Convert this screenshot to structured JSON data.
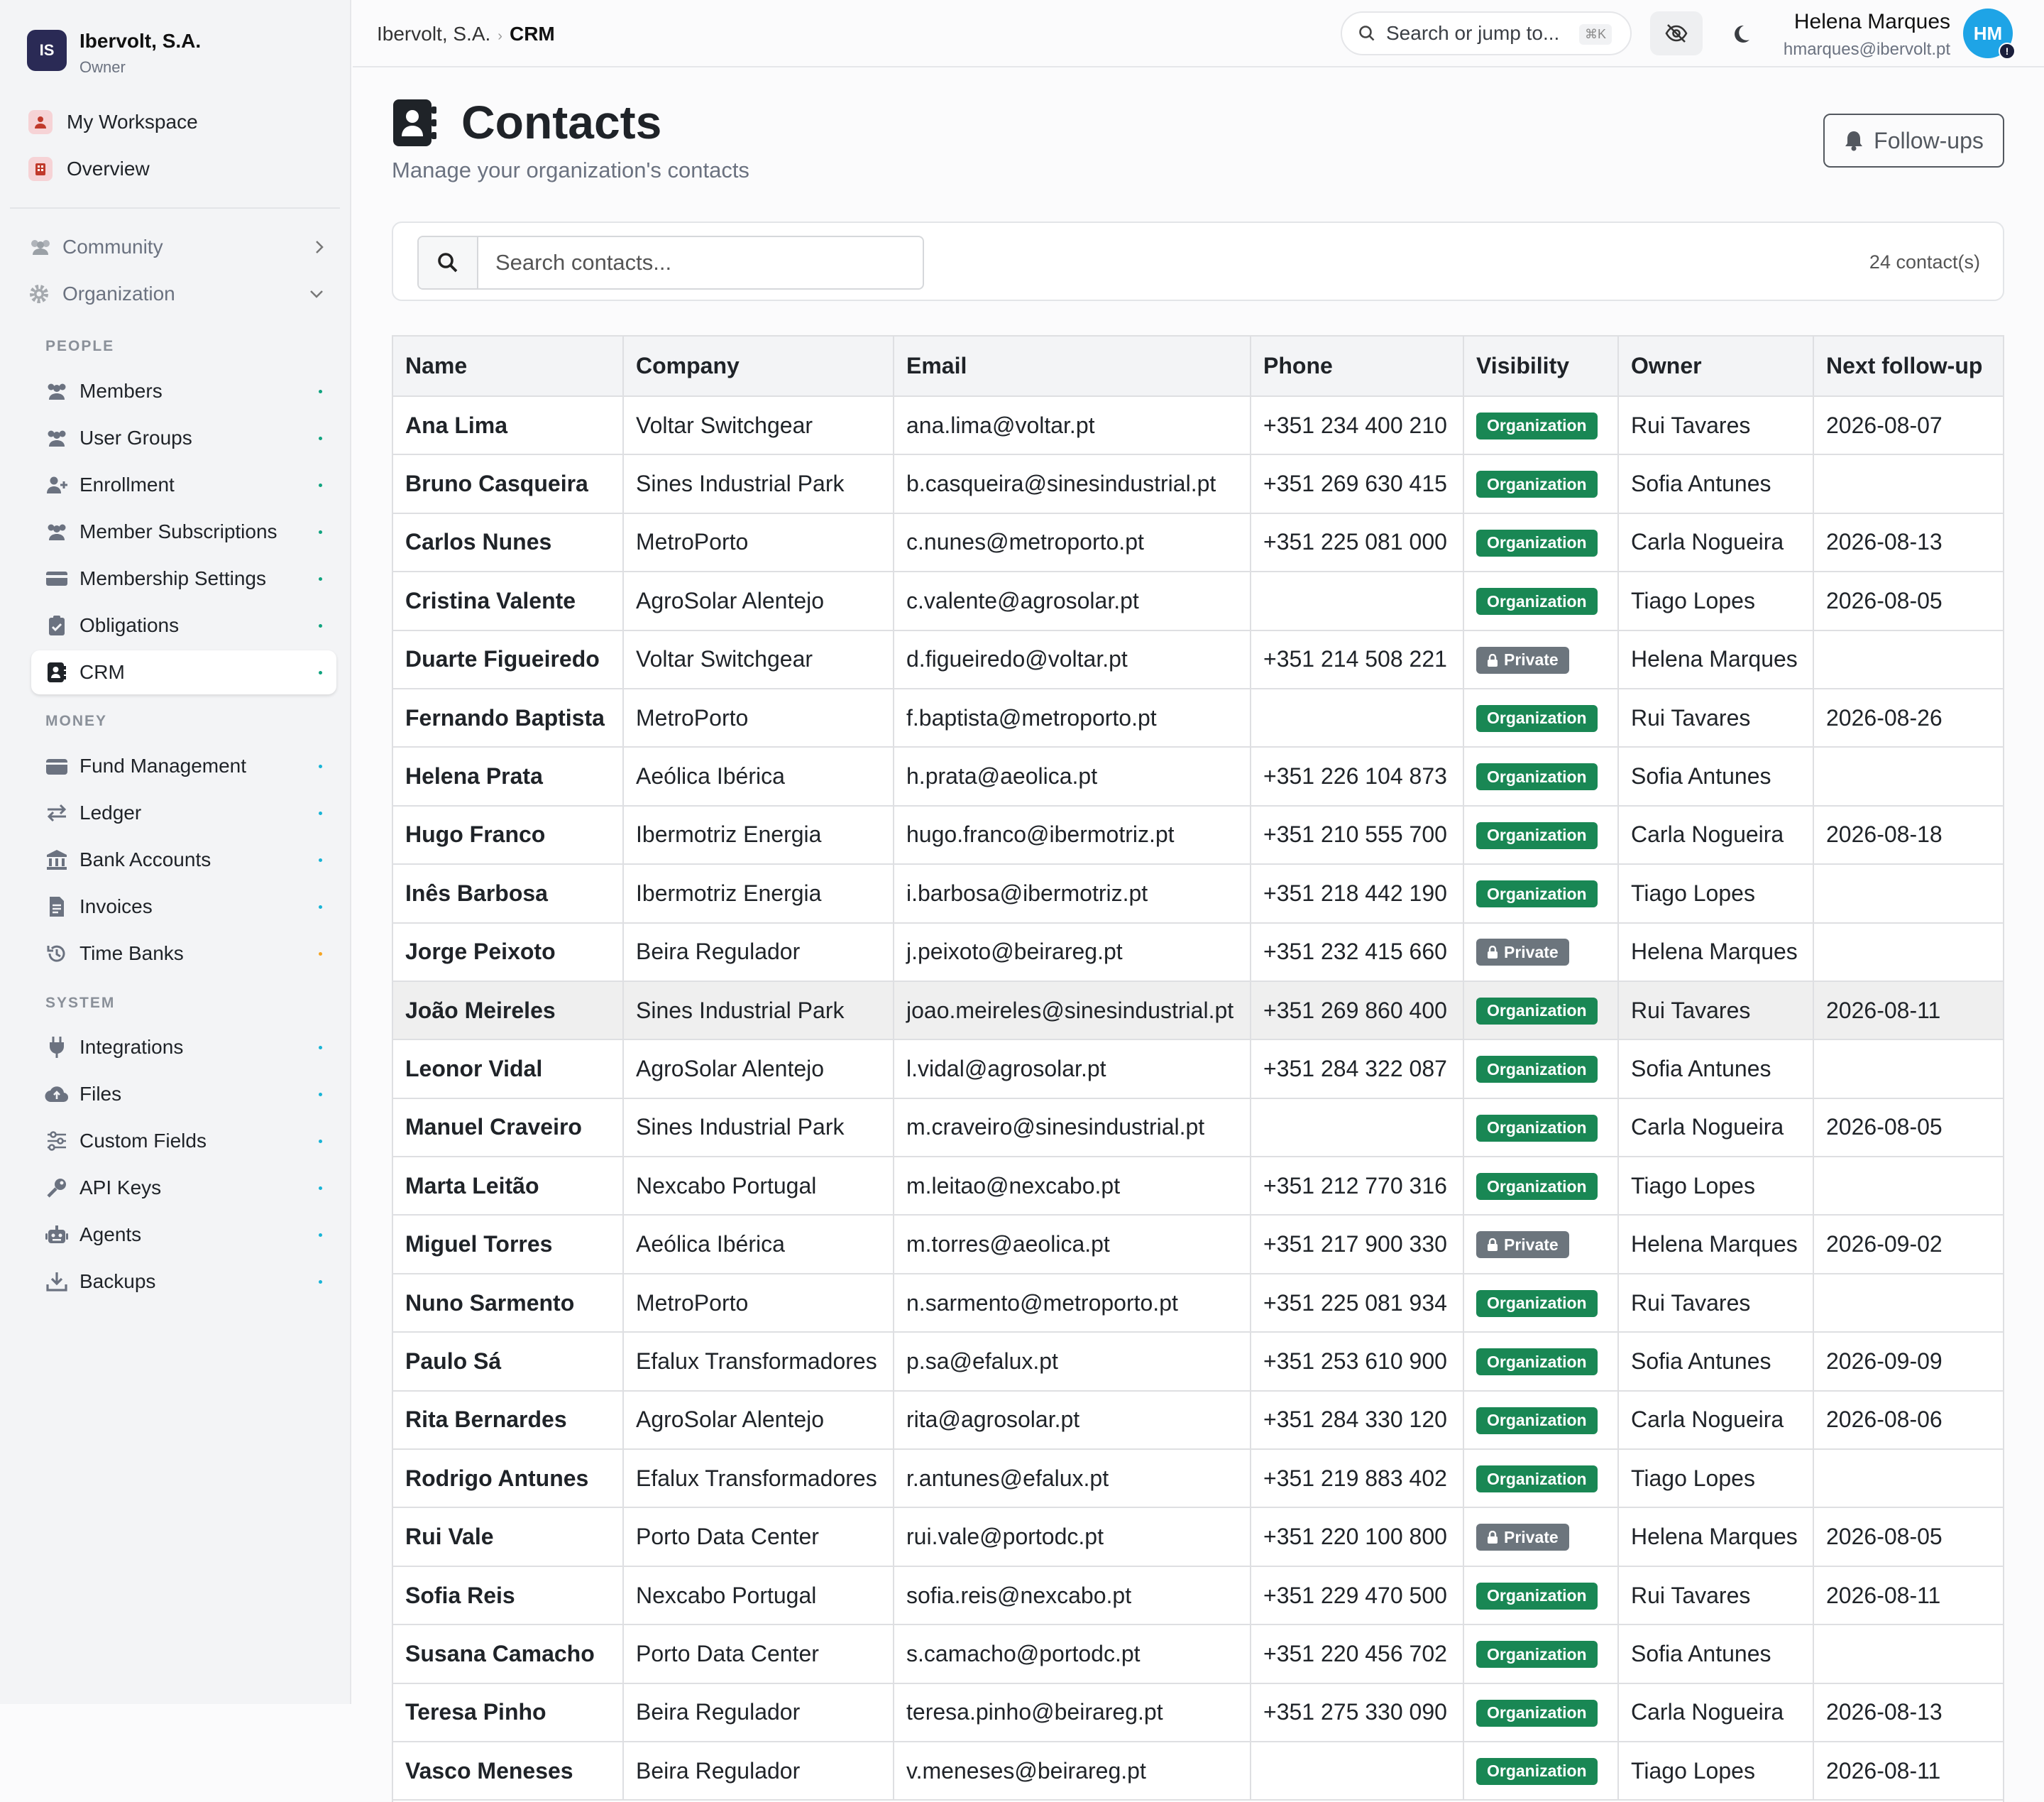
{
  "org": {
    "initials": "IS",
    "name": "Ibervolt, S.A.",
    "role": "Owner"
  },
  "sidebar": {
    "top_links": [
      {
        "label": "My Workspace",
        "icon": "user-icon"
      },
      {
        "label": "Overview",
        "icon": "building-icon"
      }
    ],
    "groups": [
      {
        "label": "Community",
        "icon": "people-icon"
      },
      {
        "label": "Organization",
        "icon": "gear-icon"
      }
    ],
    "sections": {
      "people": "PEOPLE",
      "money": "MONEY",
      "system": "SYSTEM"
    },
    "items": [
      {
        "label": "Members",
        "icon": "members-icon"
      },
      {
        "label": "User Groups",
        "icon": "user-groups-icon"
      },
      {
        "label": "Enrollment",
        "icon": "user-plus-icon"
      },
      {
        "label": "Member Subscriptions",
        "icon": "subscriptions-icon"
      },
      {
        "label": "Membership Settings",
        "icon": "card-icon"
      },
      {
        "label": "Obligations",
        "icon": "clipboard-icon"
      },
      {
        "label": "CRM",
        "icon": "contact-book-icon"
      },
      {
        "label": "Fund Management",
        "icon": "wallet-icon"
      },
      {
        "label": "Ledger",
        "icon": "arrows-icon"
      },
      {
        "label": "Bank Accounts",
        "icon": "bank-icon"
      },
      {
        "label": "Invoices",
        "icon": "invoice-icon"
      },
      {
        "label": "Time Banks",
        "icon": "history-icon"
      },
      {
        "label": "Integrations",
        "icon": "plug-icon"
      },
      {
        "label": "Files",
        "icon": "cloud-icon"
      },
      {
        "label": "Custom Fields",
        "icon": "sliders-icon"
      },
      {
        "label": "API Keys",
        "icon": "key-icon"
      },
      {
        "label": "Agents",
        "icon": "robot-icon"
      },
      {
        "label": "Backups",
        "icon": "download-icon"
      }
    ]
  },
  "topbar": {
    "breadcrumb": [
      "Ibervolt, S.A.",
      "CRM"
    ],
    "search_label": "Search or jump to...",
    "search_shortcut": "⌘K",
    "user_name": "Helena Marques",
    "user_email": "hmarques@ibervolt.pt",
    "user_initials": "HM",
    "user_badge": "!"
  },
  "page": {
    "title": "Contacts",
    "subtitle": "Manage your organization's contacts",
    "followups_label": "Follow-ups",
    "search_placeholder": "Search contacts...",
    "count_label": "24 contact(s)"
  },
  "table": {
    "columns": [
      "Name",
      "Company",
      "Email",
      "Phone",
      "Visibility",
      "Owner",
      "Next follow-up"
    ],
    "rows": [
      [
        "Ana Lima",
        "Voltar Switchgear",
        "ana.lima@voltar.pt",
        "+351 234 400 210",
        "Organization",
        "Rui Tavares",
        "2026-08-07"
      ],
      [
        "Bruno Casqueira",
        "Sines Industrial Park",
        "b.casqueira@sinesindustrial.pt",
        "+351 269 630 415",
        "Organization",
        "Sofia Antunes",
        ""
      ],
      [
        "Carlos Nunes",
        "MetroPorto",
        "c.nunes@metroporto.pt",
        "+351 225 081 000",
        "Organization",
        "Carla Nogueira",
        "2026-08-13"
      ],
      [
        "Cristina Valente",
        "AgroSolar Alentejo",
        "c.valente@agrosolar.pt",
        "",
        "Organization",
        "Tiago Lopes",
        "2026-08-05"
      ],
      [
        "Duarte Figueiredo",
        "Voltar Switchgear",
        "d.figueiredo@voltar.pt",
        "+351 214 508 221",
        "Private",
        "Helena Marques",
        ""
      ],
      [
        "Fernando Baptista",
        "MetroPorto",
        "f.baptista@metroporto.pt",
        "",
        "Organization",
        "Rui Tavares",
        "2026-08-26"
      ],
      [
        "Helena Prata",
        "Aeólica Ibérica",
        "h.prata@aeolica.pt",
        "+351 226 104 873",
        "Organization",
        "Sofia Antunes",
        ""
      ],
      [
        "Hugo Franco",
        "Ibermotriz Energia",
        "hugo.franco@ibermotriz.pt",
        "+351 210 555 700",
        "Organization",
        "Carla Nogueira",
        "2026-08-18"
      ],
      [
        "Inês Barbosa",
        "Ibermotriz Energia",
        "i.barbosa@ibermotriz.pt",
        "+351 218 442 190",
        "Organization",
        "Tiago Lopes",
        ""
      ],
      [
        "Jorge Peixoto",
        "Beira Regulador",
        "j.peixoto@beirareg.pt",
        "+351 232 415 660",
        "Private",
        "Helena Marques",
        ""
      ],
      [
        "João Meireles",
        "Sines Industrial Park",
        "joao.meireles@sinesindustrial.pt",
        "+351 269 860 400",
        "Organization",
        "Rui Tavares",
        "2026-08-11"
      ],
      [
        "Leonor Vidal",
        "AgroSolar Alentejo",
        "l.vidal@agrosolar.pt",
        "+351 284 322 087",
        "Organization",
        "Sofia Antunes",
        ""
      ],
      [
        "Manuel Craveiro",
        "Sines Industrial Park",
        "m.craveiro@sinesindustrial.pt",
        "",
        "Organization",
        "Carla Nogueira",
        "2026-08-05"
      ],
      [
        "Marta Leitão",
        "Nexcabo Portugal",
        "m.leitao@nexcabo.pt",
        "+351 212 770 316",
        "Organization",
        "Tiago Lopes",
        ""
      ],
      [
        "Miguel Torres",
        "Aeólica Ibérica",
        "m.torres@aeolica.pt",
        "+351 217 900 330",
        "Private",
        "Helena Marques",
        "2026-09-02"
      ],
      [
        "Nuno Sarmento",
        "MetroPorto",
        "n.sarmento@metroporto.pt",
        "+351 225 081 934",
        "Organization",
        "Rui Tavares",
        ""
      ],
      [
        "Paulo Sá",
        "Efalux Transformadores",
        "p.sa@efalux.pt",
        "+351 253 610 900",
        "Organization",
        "Sofia Antunes",
        "2026-09-09"
      ],
      [
        "Rita Bernardes",
        "AgroSolar Alentejo",
        "rita@agrosolar.pt",
        "+351 284 330 120",
        "Organization",
        "Carla Nogueira",
        "2026-08-06"
      ],
      [
        "Rodrigo Antunes",
        "Efalux Transformadores",
        "r.antunes@efalux.pt",
        "+351 219 883 402",
        "Organization",
        "Tiago Lopes",
        ""
      ],
      [
        "Rui Vale",
        "Porto Data Center",
        "rui.vale@portodc.pt",
        "+351 220 100 800",
        "Private",
        "Helena Marques",
        "2026-08-05"
      ],
      [
        "Sofia Reis",
        "Nexcabo Portugal",
        "sofia.reis@nexcabo.pt",
        "+351 229 470 500",
        "Organization",
        "Rui Tavares",
        "2026-08-11"
      ],
      [
        "Susana Camacho",
        "Porto Data Center",
        "s.camacho@portodc.pt",
        "+351 220 456 702",
        "Organization",
        "Sofia Antunes",
        ""
      ],
      [
        "Teresa Pinho",
        "Beira Regulador",
        "teresa.pinho@beirareg.pt",
        "+351 275 330 090",
        "Organization",
        "Carla Nogueira",
        "2026-08-13"
      ],
      [
        "Vasco Meneses",
        "Beira Regulador",
        "v.meneses@beirareg.pt",
        "",
        "Organization",
        "Tiago Lopes",
        "2026-08-11"
      ]
    ]
  },
  "colors": {
    "accent": "#1ea4e6",
    "org_badge": "#198754",
    "private_badge": "#6c757d",
    "org_avatar": "#2a2a55",
    "status_green": "#10a37f",
    "status_amber": "#f5a524"
  }
}
